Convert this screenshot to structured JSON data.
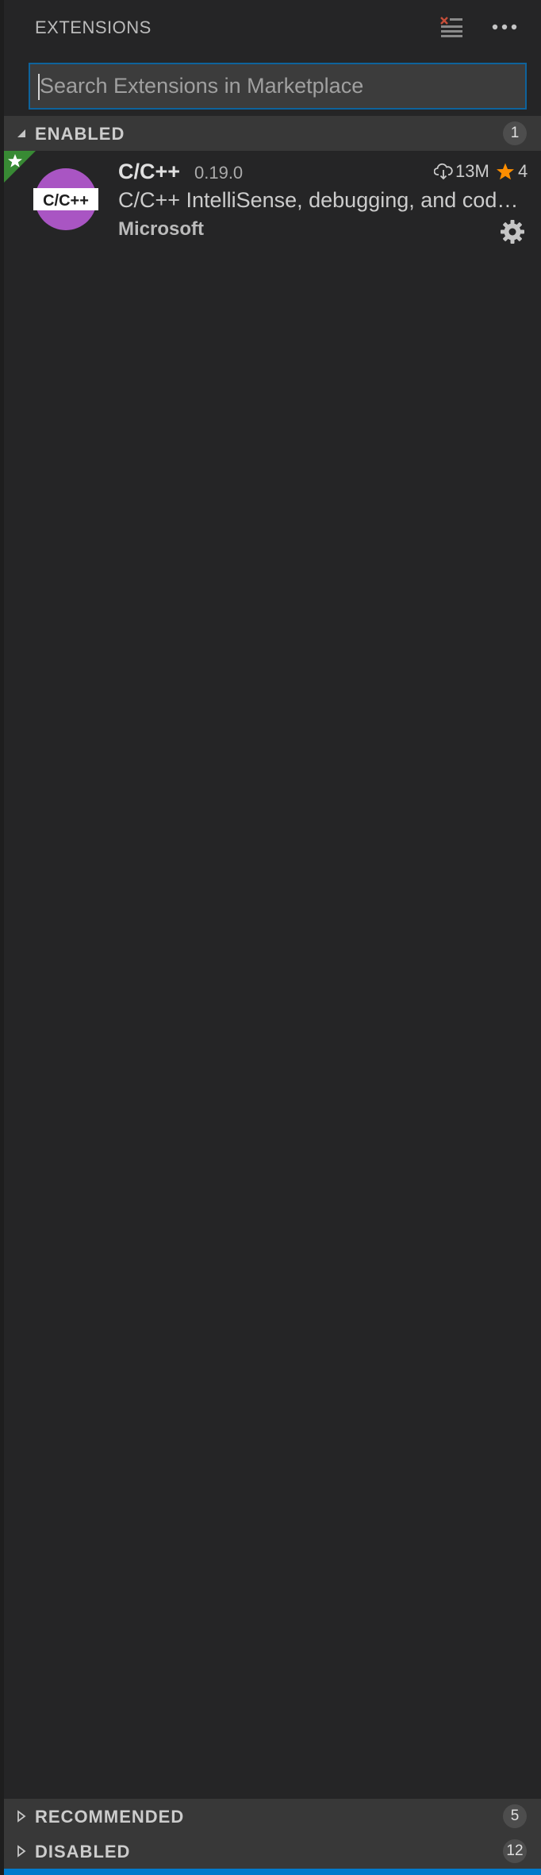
{
  "header": {
    "title": "EXTENSIONS"
  },
  "search": {
    "placeholder": "Search Extensions in Marketplace",
    "value": ""
  },
  "sections": {
    "enabled": {
      "label": "ENABLED",
      "count": "1",
      "expanded": true
    },
    "recommended": {
      "label": "RECOMMENDED",
      "count": "5",
      "expanded": false
    },
    "disabled": {
      "label": "DISABLED",
      "count": "12",
      "expanded": false
    }
  },
  "extension": {
    "name": "C/C++",
    "version": "0.19.0",
    "downloads": "13M",
    "rating": "4",
    "description": "C/C++ IntelliSense, debugging, and code browsing.",
    "publisher": "Microsoft",
    "logo_text": "C/C++"
  },
  "icons": {
    "clear": "clear-extensions-icon",
    "more": "ellipsis-icon",
    "download": "cloud-download-icon",
    "star": "star-icon",
    "gear": "gear-icon"
  },
  "colors": {
    "accent": "#007acc",
    "focus_border": "#0e639c",
    "star": "#ff8e00",
    "recommended_corner": "#388a34",
    "logo_purple": "#a955c3"
  }
}
